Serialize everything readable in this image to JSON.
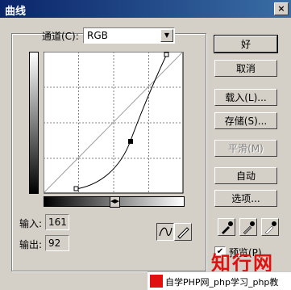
{
  "window": {
    "title": "曲线",
    "close_label": "×"
  },
  "channel": {
    "label": "通道(C):",
    "value": "RGB"
  },
  "readouts": {
    "input_label": "输入:",
    "input_value": "161",
    "output_label": "输出:",
    "output_value": "92"
  },
  "buttons": {
    "ok": "好",
    "cancel": "取消",
    "load": "载入(L)...",
    "save": "存储(S)...",
    "smooth": "平滑(M)",
    "auto": "自动",
    "options": "选项..."
  },
  "preview": {
    "label": "预览(P)",
    "checked": true
  },
  "curve": {
    "points": [
      [
        0,
        0
      ],
      [
        161,
        92
      ],
      [
        255,
        255
      ]
    ],
    "selected_point": [
      161,
      92
    ]
  },
  "watermark": {
    "logo_text": "知行网",
    "bar_text": "自学PHP网_php学习_php教"
  },
  "icons": {
    "curve_tool": "curve-icon",
    "pencil_tool": "pencil-icon",
    "black_eyedropper": "black-eyedropper-icon",
    "gray_eyedropper": "gray-eyedropper-icon",
    "white_eyedropper": "white-eyedropper-icon"
  }
}
